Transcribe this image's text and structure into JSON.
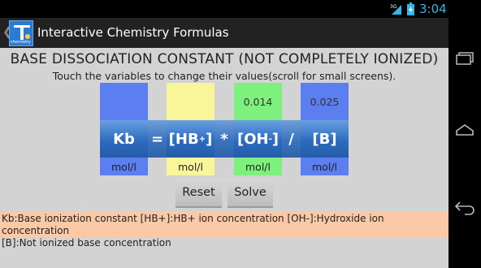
{
  "status_bar": {
    "network": "3G",
    "time": "3:04"
  },
  "action_bar": {
    "title": "Interactive Chemistry Formulas",
    "icon_label": "chemistry"
  },
  "heading": "BASE DISSOCIATION CONSTANT (NOT COMPLETELY IONIZED)",
  "subheading": "Touch the variables to change their values(scroll for small screens).",
  "formula": {
    "kb": {
      "symbol": "Kb",
      "value": "",
      "unit": "mol/l",
      "color": "#5b7ef0"
    },
    "hb": {
      "symbol": "[HB",
      "sup": "+",
      "close": "]",
      "value": "",
      "unit": "mol/l",
      "color": "#f8f59a"
    },
    "oh": {
      "symbol": "[OH",
      "sup": "-",
      "close": "]",
      "value": "0.014",
      "unit": "mol/l",
      "color": "#7ef07e"
    },
    "b": {
      "symbol": "[B]",
      "value": "0.025",
      "unit": "mol/l",
      "color": "#5b7ef0"
    },
    "ops": {
      "equals": "=",
      "times": "*",
      "divide": "/"
    }
  },
  "buttons": {
    "reset": "Reset",
    "solve": "Solve"
  },
  "info": {
    "line1": "Kb:Base ionization constant  [HB+]:HB+ ion concentration  [OH-]:Hydroxide ion concentration",
    "line2": "[B]:Not ionized base concentration"
  }
}
